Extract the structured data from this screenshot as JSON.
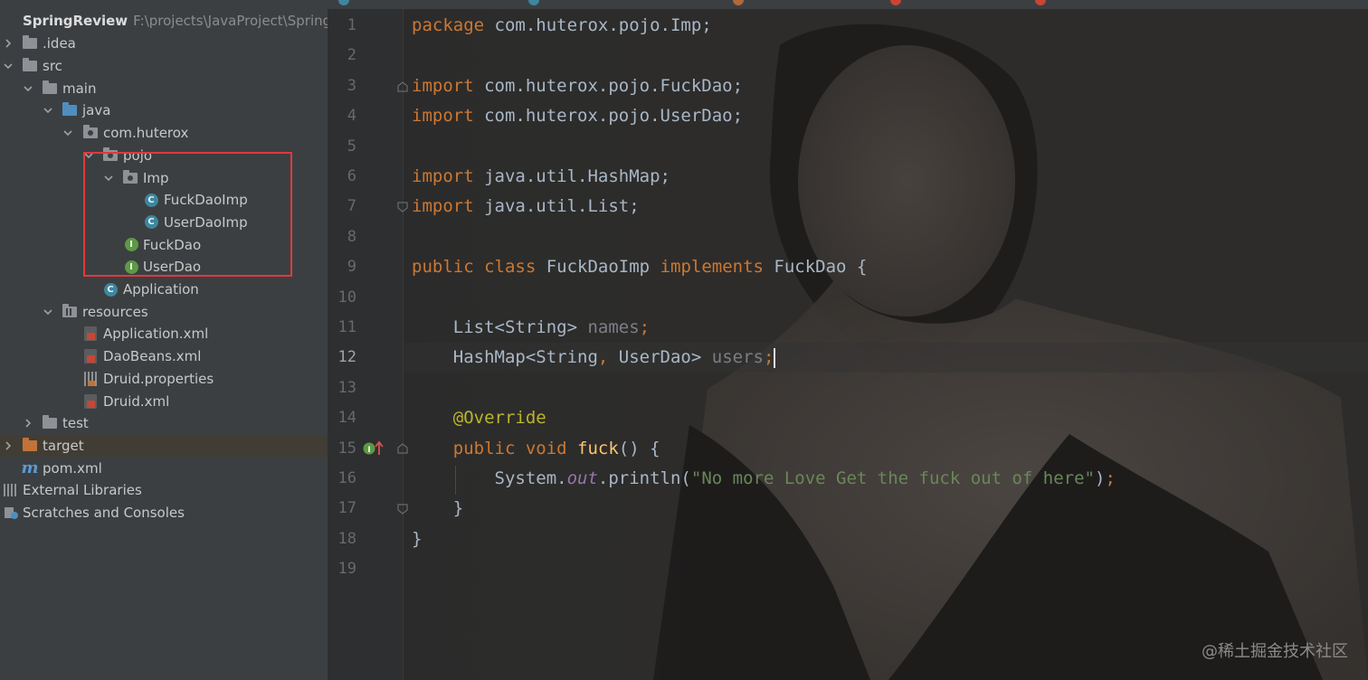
{
  "project": {
    "name": "SpringReview",
    "path": "F:\\projects\\JavaProject\\SpringR",
    "items": [
      {
        "label": ".idea",
        "icon": "folder-icon",
        "expanded": false
      },
      {
        "label": "src",
        "icon": "folder-icon",
        "expanded": true
      },
      {
        "label": "main",
        "icon": "folder-icon",
        "expanded": true
      },
      {
        "label": "java",
        "icon": "source-folder-icon",
        "expanded": true
      },
      {
        "label": "com.huterox",
        "icon": "package-icon",
        "expanded": true
      },
      {
        "label": "pojo",
        "icon": "package-icon",
        "expanded": true
      },
      {
        "label": "Imp",
        "icon": "package-icon",
        "expanded": true
      },
      {
        "label": "FuckDaoImp",
        "icon": "class-icon"
      },
      {
        "label": "UserDaoImp",
        "icon": "class-icon"
      },
      {
        "label": "FuckDao",
        "icon": "interface-icon"
      },
      {
        "label": "UserDao",
        "icon": "interface-icon"
      },
      {
        "label": "Application",
        "icon": "main-class-icon"
      },
      {
        "label": "resources",
        "icon": "resources-folder-icon",
        "expanded": true
      },
      {
        "label": "Application.xml",
        "icon": "spring-xml-icon"
      },
      {
        "label": "DaoBeans.xml",
        "icon": "spring-xml-icon"
      },
      {
        "label": "Druid.properties",
        "icon": "properties-icon"
      },
      {
        "label": "Druid.xml",
        "icon": "spring-xml-icon"
      },
      {
        "label": "test",
        "icon": "folder-icon",
        "expanded": false
      },
      {
        "label": "target",
        "icon": "excluded-folder-icon",
        "expanded": false
      },
      {
        "label": "pom.xml",
        "icon": "maven-icon"
      },
      {
        "label": "External Libraries",
        "icon": "libraries-icon",
        "expanded": false
      },
      {
        "label": "Scratches and Consoles",
        "icon": "scratches-icon"
      }
    ]
  },
  "editor": {
    "current_line": 12,
    "line_numbers": [
      "1",
      "2",
      "3",
      "4",
      "5",
      "6",
      "7",
      "8",
      "9",
      "10",
      "11",
      "12",
      "13",
      "14",
      "15",
      "16",
      "17",
      "18",
      "19"
    ],
    "code": {
      "l1_kw": "package",
      "l1_rest": " com.huterox.pojo.Imp;",
      "l3_kw": "import",
      "l3_rest": " com.huterox.pojo.FuckDao;",
      "l4_kw": "import",
      "l4_rest": " com.huterox.pojo.UserDao;",
      "l6_kw": "import",
      "l6_rest": " java.util.HashMap;",
      "l7_kw": "import",
      "l7_rest": " java.util.List;",
      "l9_kw1": "public class",
      "l9_name": " FuckDaoImp ",
      "l9_kw2": "implements",
      "l9_rest": " FuckDao {",
      "l11_type": "    List<String> ",
      "l11_field": "names",
      "l11_semi": ";",
      "l12_type": "    HashMap<String",
      "l12_comma": ",",
      "l12_type2": " UserDao> ",
      "l12_field": "users",
      "l12_semi": ";",
      "l14_ann": "    @Override",
      "l15_kw": "    public void ",
      "l15_fn": "fuck",
      "l15_rest": "() {",
      "l16_a": "        System.",
      "l16_static": "out",
      "l16_b": ".println(",
      "l16_str": "\"No more Love Get the fuck out of here\"",
      "l16_c": ")",
      "l16_semi": ";",
      "l17": "    }",
      "l18": "}"
    }
  },
  "watermark": "@稀土掘金技术社区",
  "colors": {
    "keyword": "#cc7832",
    "annotation": "#bbb529",
    "string": "#6a8759",
    "static_field": "#9876aa",
    "highlight_box": "#e0393e"
  }
}
